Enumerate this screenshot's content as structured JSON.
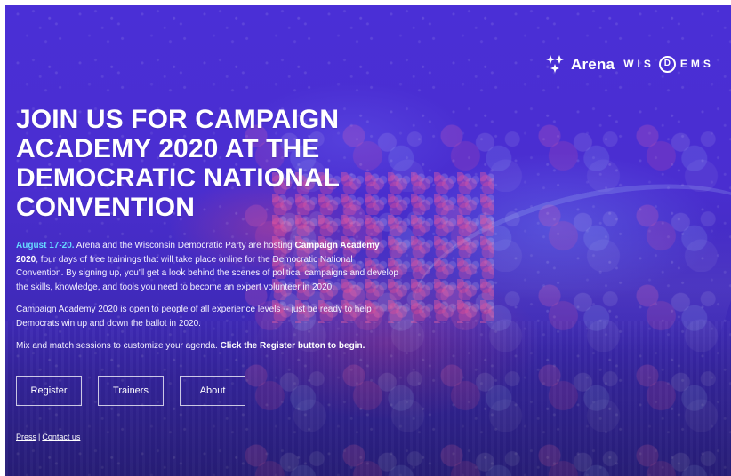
{
  "header": {
    "brand_primary": "Arena",
    "brand_secondary_left": "WIS",
    "brand_secondary_right": "EMS",
    "brand_secondary_badge": "D"
  },
  "hero": {
    "title": "JOIN US FOR CAMPAIGN ACADEMY 2020 AT THE DEMOCRATIC NATIONAL CONVENTION",
    "dates": "August 17-20.",
    "paragraph_1_pre": " Arena and the Wisconsin Democratic Party are hosting ",
    "paragraph_1_bold": "Campaign Academy 2020",
    "paragraph_1_post": ", four days of free trainings that will take place online for the Democratic National Convention. By signing up, you'll get a look behind the scenes of political campaigns and develop the skills, knowledge, and tools you need to become an expert volunteer in 2020.",
    "paragraph_2": "Campaign Academy 2020 is open to people of all experience levels -- just be ready to help Democrats win up and down the ballot in 2020.",
    "paragraph_3_pre": "Mix and match sessions to customize your agenda. ",
    "paragraph_3_bold": "Click the Register button to begin."
  },
  "buttons": {
    "register": "Register",
    "trainers": "Trainers",
    "about": "About"
  },
  "footer": {
    "press": "Press",
    "separator": "|",
    "contact": "Contact us"
  }
}
